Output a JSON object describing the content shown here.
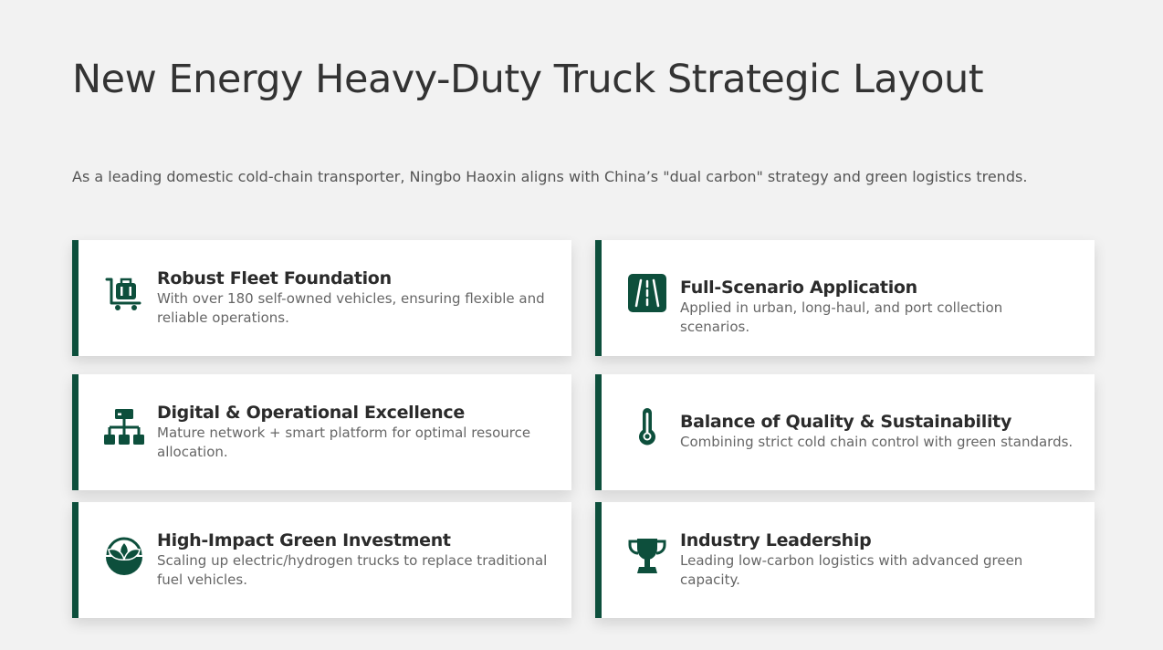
{
  "page": {
    "title": "New Energy Heavy-Duty Truck Strategic Layout",
    "subtitle": "As a leading domestic cold-chain transporter, Ningbo Haoxin aligns with China’s \"dual carbon\" strategy and green logistics trends."
  },
  "colors": {
    "accent": "#0d4f3c",
    "background": "#f2f2f2",
    "card": "#ffffff"
  },
  "cards": [
    {
      "icon": "luggage-cart-icon",
      "title": "Robust Fleet Foundation",
      "description": "With over 180 self-owned vehicles, ensuring flexible and reliable operations."
    },
    {
      "icon": "road-icon",
      "title": "Full-Scenario Application",
      "description": "Applied in urban, long-haul, and port collection scenarios."
    },
    {
      "icon": "network-hierarchy-icon",
      "title": "Digital & Operational Excellence",
      "description": "Mature network + smart platform for optimal resource allocation."
    },
    {
      "icon": "thermometer-icon",
      "title": "Balance of Quality & Sustainability",
      "description": "Combining strict cold chain control with green standards."
    },
    {
      "icon": "seedling-icon",
      "title": "High-Impact Green Investment",
      "description": "Scaling up electric/hydrogen trucks to replace traditional fuel vehicles."
    },
    {
      "icon": "trophy-icon",
      "title": "Industry Leadership",
      "description": "Leading low-carbon logistics with advanced green capacity."
    }
  ]
}
